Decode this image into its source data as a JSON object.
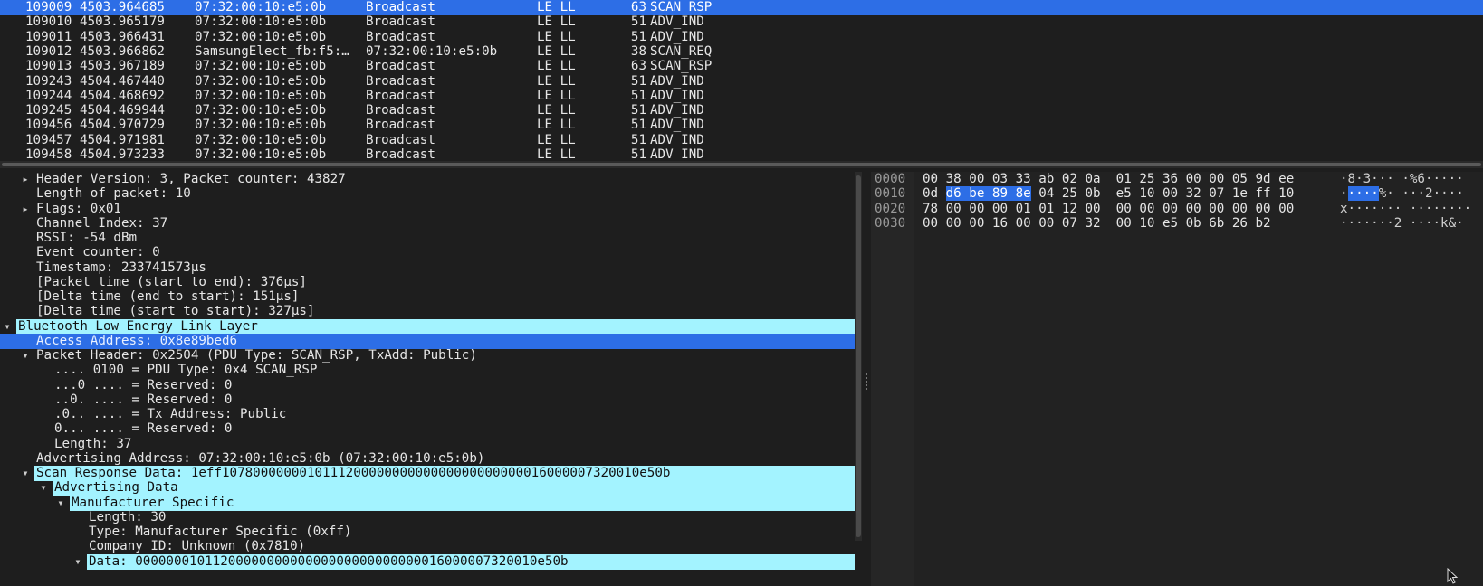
{
  "packet_list": {
    "rows": [
      {
        "no": "109009",
        "time": "4503.964685",
        "src": "07:32:00:10:e5:0b",
        "dst": "Broadcast",
        "proto": "LE LL",
        "len": "63",
        "info": "SCAN_RSP",
        "selected": true
      },
      {
        "no": "109010",
        "time": "4503.965179",
        "src": "07:32:00:10:e5:0b",
        "dst": "Broadcast",
        "proto": "LE LL",
        "len": "51",
        "info": "ADV_IND"
      },
      {
        "no": "109011",
        "time": "4503.966431",
        "src": "07:32:00:10:e5:0b",
        "dst": "Broadcast",
        "proto": "LE LL",
        "len": "51",
        "info": "ADV_IND"
      },
      {
        "no": "109012",
        "time": "4503.966862",
        "src": "SamsungElect_fb:f5:…",
        "dst": "07:32:00:10:e5:0b",
        "proto": "LE LL",
        "len": "38",
        "info": "SCAN_REQ"
      },
      {
        "no": "109013",
        "time": "4503.967189",
        "src": "07:32:00:10:e5:0b",
        "dst": "Broadcast",
        "proto": "LE LL",
        "len": "63",
        "info": "SCAN_RSP"
      },
      {
        "no": "109243",
        "time": "4504.467440",
        "src": "07:32:00:10:e5:0b",
        "dst": "Broadcast",
        "proto": "LE LL",
        "len": "51",
        "info": "ADV_IND"
      },
      {
        "no": "109244",
        "time": "4504.468692",
        "src": "07:32:00:10:e5:0b",
        "dst": "Broadcast",
        "proto": "LE LL",
        "len": "51",
        "info": "ADV_IND"
      },
      {
        "no": "109245",
        "time": "4504.469944",
        "src": "07:32:00:10:e5:0b",
        "dst": "Broadcast",
        "proto": "LE LL",
        "len": "51",
        "info": "ADV_IND"
      },
      {
        "no": "109456",
        "time": "4504.970729",
        "src": "07:32:00:10:e5:0b",
        "dst": "Broadcast",
        "proto": "LE LL",
        "len": "51",
        "info": "ADV_IND"
      },
      {
        "no": "109457",
        "time": "4504.971981",
        "src": "07:32:00:10:e5:0b",
        "dst": "Broadcast",
        "proto": "LE LL",
        "len": "51",
        "info": "ADV_IND"
      },
      {
        "no": "109458",
        "time": "4504.973233",
        "src": "07:32:00:10:e5:0b",
        "dst": "Broadcast",
        "proto": "LE LL",
        "len": "51",
        "info": "ADV_IND"
      }
    ]
  },
  "details": {
    "rows": [
      {
        "level": 1,
        "arrow": "right",
        "text": "Header Version: 3, Packet counter: 43827"
      },
      {
        "level": 1,
        "arrow": "",
        "text": "Length of packet: 10"
      },
      {
        "level": 1,
        "arrow": "right",
        "text": "Flags: 0x01"
      },
      {
        "level": 1,
        "arrow": "",
        "text": "Channel Index: 37"
      },
      {
        "level": 1,
        "arrow": "",
        "text": "RSSI: -54 dBm"
      },
      {
        "level": 1,
        "arrow": "",
        "text": "Event counter: 0"
      },
      {
        "level": 1,
        "arrow": "",
        "text": "Timestamp: 233741573µs"
      },
      {
        "level": 1,
        "arrow": "",
        "text": "[Packet time (start to end): 376µs]"
      },
      {
        "level": 1,
        "arrow": "",
        "text": "[Delta time (end to start): 151µs]"
      },
      {
        "level": 1,
        "arrow": "",
        "text": "[Delta time (start to start): 327µs]"
      },
      {
        "level": 0,
        "arrow": "down",
        "text": "Bluetooth Low Energy Link Layer",
        "hl": "cyan"
      },
      {
        "level": 1,
        "arrow": "",
        "text": "Access Address: 0x8e89bed6",
        "hl": "blue",
        "full": true
      },
      {
        "level": 1,
        "arrow": "down",
        "text": "Packet Header: 0x2504 (PDU Type: SCAN_RSP, TxAdd: Public)"
      },
      {
        "level": 2,
        "arrow": "",
        "text": ".... 0100 = PDU Type: 0x4 SCAN_RSP"
      },
      {
        "level": 2,
        "arrow": "",
        "text": "...0 .... = Reserved: 0"
      },
      {
        "level": 2,
        "arrow": "",
        "text": "..0. .... = Reserved: 0"
      },
      {
        "level": 2,
        "arrow": "",
        "text": ".0.. .... = Tx Address: Public"
      },
      {
        "level": 2,
        "arrow": "",
        "text": "0... .... = Reserved: 0"
      },
      {
        "level": 2,
        "arrow": "",
        "text": "Length: 37"
      },
      {
        "level": 1,
        "arrow": "",
        "text": "Advertising Address: 07:32:00:10:e5:0b (07:32:00:10:e5:0b)"
      },
      {
        "level": 1,
        "arrow": "down",
        "text": "Scan Response Data: 1eff107800000001011120000000000000000000000016000007320010e50b",
        "hl": "cyan"
      },
      {
        "level": 2,
        "arrow": "down",
        "text": "Advertising Data",
        "hl": "cyan"
      },
      {
        "level": 3,
        "arrow": "down",
        "text": "Manufacturer Specific",
        "hl": "cyan"
      },
      {
        "level": 4,
        "arrow": "",
        "text": "Length: 30"
      },
      {
        "level": 4,
        "arrow": "",
        "text": "Type: Manufacturer Specific (0xff)"
      },
      {
        "level": 4,
        "arrow": "",
        "text": "Company ID: Unknown (0x7810)"
      },
      {
        "level": 4,
        "arrow": "down",
        "text": "Data: 0000000101120000000000000000000000000016000007320010e50b",
        "hl": "cyan"
      }
    ]
  },
  "hex": {
    "rows": [
      {
        "offset": "0000",
        "bytes": [
          "00",
          "38",
          "00",
          "03",
          "33",
          "ab",
          "02",
          "0a",
          "01",
          "25",
          "36",
          "00",
          "00",
          "05",
          "9d",
          "ee"
        ],
        "ascii": "·8·3··· ·%6·····"
      },
      {
        "offset": "0010",
        "bytes": [
          "0d",
          "d6",
          "be",
          "89",
          "8e",
          "04",
          "25",
          "0b",
          "e5",
          "10",
          "00",
          "32",
          "07",
          "1e",
          "ff",
          "10"
        ],
        "ascii": "·····%· ···2····",
        "sel": [
          1,
          2,
          3,
          4
        ]
      },
      {
        "offset": "0020",
        "bytes": [
          "78",
          "00",
          "00",
          "00",
          "01",
          "01",
          "12",
          "00",
          "00",
          "00",
          "00",
          "00",
          "00",
          "00",
          "00",
          "00"
        ],
        "ascii": "x······· ········"
      },
      {
        "offset": "0030",
        "bytes": [
          "00",
          "00",
          "00",
          "16",
          "00",
          "00",
          "07",
          "32",
          "00",
          "10",
          "e5",
          "0b",
          "6b",
          "26",
          "b2"
        ],
        "ascii": "·······2 ····k&·"
      }
    ]
  }
}
